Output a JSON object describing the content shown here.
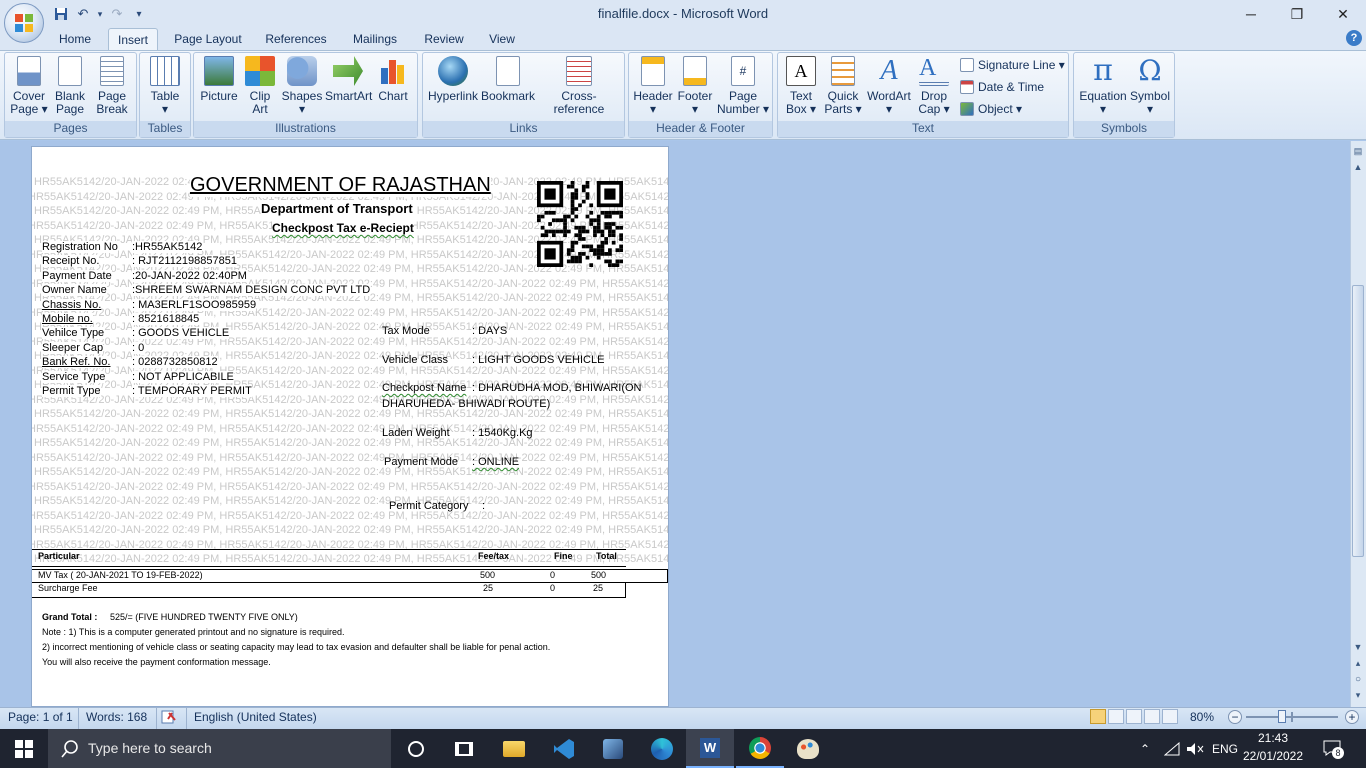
{
  "window": {
    "title": "finalfile.docx - Microsoft Word",
    "minimize": "─",
    "restore": "❐",
    "close": "✕"
  },
  "qat": {
    "save": "💾",
    "undo": "↶",
    "redo": "↷",
    "customize": "▾"
  },
  "tabs": [
    "Home",
    "Insert",
    "Page Layout",
    "References",
    "Mailings",
    "Review",
    "View"
  ],
  "active_tab": "Insert",
  "ribbon": {
    "pages": {
      "label": "Pages",
      "cover": "Cover\nPage ▾",
      "blank": "Blank\nPage",
      "break": "Page\nBreak"
    },
    "tables": {
      "label": "Tables",
      "table": "Table\n▾"
    },
    "illustrations": {
      "label": "Illustrations",
      "picture": "Picture",
      "clipart": "Clip\nArt",
      "shapes": "Shapes\n▾",
      "smartart": "SmartArt",
      "chart": "Chart"
    },
    "links": {
      "label": "Links",
      "hyperlink": "Hyperlink",
      "bookmark": "Bookmark",
      "crossref": "Cross-reference"
    },
    "headerfooter": {
      "label": "Header & Footer",
      "header": "Header\n▾",
      "footer": "Footer\n▾",
      "pagenumber": "Page\nNumber ▾"
    },
    "text": {
      "label": "Text",
      "textbox": "Text\nBox ▾",
      "quickparts": "Quick\nParts ▾",
      "wordart": "WordArt\n▾",
      "dropcap": "Drop\nCap ▾",
      "signature": "Signature Line ▾",
      "datetime": "Date & Time",
      "object": "Object ▾"
    },
    "symbols": {
      "label": "Symbols",
      "equation": "Equation\n▾",
      "symbol": "Symbol\n▾"
    }
  },
  "doc": {
    "watermark": "HR55AK5142/20-JAN-2022 02:49 PM,",
    "title": "GOVERNMENT OF RAJASTHAN",
    "dept": "Department of Transport",
    "subtitle": "Checkpost Tax e-Reciept",
    "left_fields": [
      {
        "label": "Registration No",
        "value": ":HR55AK5142"
      },
      {
        "label": "Receipt No.",
        "value": ": RJT2112198857851"
      },
      {
        "label": "Payment Date",
        "value": ":20-JAN-2022 02:40PM"
      },
      {
        "label": "Owner Name",
        "value": ":SHREEM SWARNAM DESIGN CONC PVT LTD"
      },
      {
        "label": "Chassis No.",
        "value": ": MA3ERLF1SOO985959"
      },
      {
        "label": "Mobile no.",
        "value": ": 8521618845"
      },
      {
        "label": "Vehilce Type",
        "value": ": GOODS VEHICLE"
      },
      {
        "label": "Sleeper Cap",
        "value": ": 0"
      },
      {
        "label": "Bank Ref. No.",
        "value": ": 0288732850812"
      },
      {
        "label": "Service Type",
        "value": ": NOT APPLICABILE"
      },
      {
        "label": "Permit Type",
        "value": ": TEMPORARY PERMIT"
      }
    ],
    "tax_mode": {
      "label": "Tax Mode",
      "value": ":  DAYS"
    },
    "vehicle_class": {
      "label": "Vehicle Class",
      "value": ": LIGHT GOODS VEHICLE"
    },
    "checkpost": {
      "label": "Checkpost Name",
      "value": ": DHARUDHA MOD, BHIWARI(ON",
      "value2": "DHARUHEDA- BHIWADI ROUTE)"
    },
    "laden": {
      "label": "Laden Weight",
      "value": ": 1540Kg.Kg"
    },
    "payment_mode": {
      "label": "Payment Mode",
      "value": ":  ONLINE"
    },
    "permit_category": {
      "label": "Permit Category",
      "value": ":"
    },
    "table": {
      "headers": [
        "Particular",
        "Fee/tax",
        "Fine",
        "Total"
      ],
      "rows": [
        [
          "MV Tax ( 20-JAN-2021 TO 19-FEB-2022)",
          "500",
          "0",
          "500"
        ],
        [
          "Surcharge Fee",
          "25",
          "0",
          "25"
        ]
      ]
    },
    "grand_total_label": "Grand Total :",
    "grand_total_value": "525/= (FIVE HUNDRED TWENTY FIVE ONLY)",
    "note1": "Note : 1) This is a computer generated printout and no signature is required.",
    "note2": "2) incorrect mentioning of vehicle class or seating capacity may lead to tax evasion  and defaulter shall be liable for penal action.",
    "note3": "You will also receive the payment conformation message."
  },
  "status": {
    "page": "Page: 1 of 1",
    "words": "Words: 168",
    "language": "English (United States)",
    "zoom": "80%",
    "zoom_level": 0.8
  },
  "taskbar": {
    "search_placeholder": "Type here to search",
    "lang": "ENG",
    "time": "21:43",
    "date": "22/01/2022",
    "notifications": "8"
  },
  "colors": {
    "ribbon_bg": "#dbe7f5",
    "doc_bg": "#a9c4e8",
    "taskbar": "#1f2430",
    "accent": "#15315a"
  }
}
